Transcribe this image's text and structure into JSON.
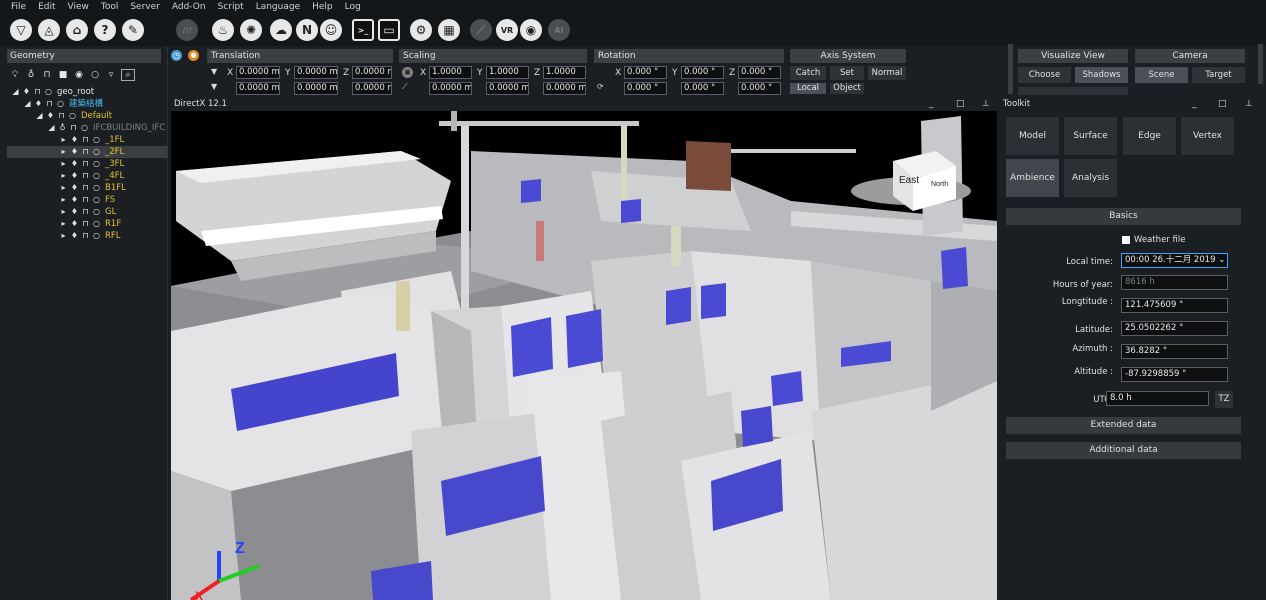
{
  "menu": [
    "File",
    "Edit",
    "View",
    "Tool",
    "Server",
    "Add-On",
    "Script",
    "Language",
    "Help",
    "Log"
  ],
  "toolbar_icons": [
    {
      "name": "filter-icon",
      "glyph": "▽"
    },
    {
      "name": "plane-icon",
      "glyph": "◬"
    },
    {
      "name": "house-icon",
      "glyph": "⌂"
    },
    {
      "name": "help-icon",
      "glyph": "?"
    },
    {
      "name": "measure-icon",
      "glyph": "✎"
    },
    {
      "name": "section-icon",
      "glyph": "///"
    },
    {
      "name": "fire-icon",
      "glyph": "♨"
    },
    {
      "name": "particle-icon",
      "glyph": "✺"
    },
    {
      "name": "weather-icon",
      "glyph": "☁"
    },
    {
      "name": "network-icon",
      "glyph": "N"
    },
    {
      "name": "person-icon",
      "glyph": "☺"
    },
    {
      "name": "console-icon",
      "glyph": ">_"
    },
    {
      "name": "window-icon",
      "glyph": "▭"
    },
    {
      "name": "settings-icon",
      "glyph": "⚙"
    },
    {
      "name": "grid-icon",
      "glyph": "▦"
    },
    {
      "name": "chart-icon",
      "glyph": "⟋"
    },
    {
      "name": "vr-icon",
      "glyph": "VR"
    },
    {
      "name": "screenshot-icon",
      "glyph": "◉"
    },
    {
      "name": "ai-icon",
      "glyph": "AI"
    }
  ],
  "geometry": {
    "title": "Geometry",
    "tree": [
      {
        "label": "geo_root",
        "depth": 0,
        "color": "white"
      },
      {
        "label": "建築結構",
        "depth": 1,
        "color": "cyan"
      },
      {
        "label": "Default",
        "depth": 2,
        "color": "yellow"
      },
      {
        "label": "IFCBUILDING_IFC",
        "depth": 3,
        "color": "grey"
      },
      {
        "label": "_1FL",
        "depth": 4,
        "color": "yellow"
      },
      {
        "label": "_2FL",
        "depth": 4,
        "color": "yellow",
        "selected": true
      },
      {
        "label": "_3FL",
        "depth": 4,
        "color": "yellow"
      },
      {
        "label": "_4FL",
        "depth": 4,
        "color": "yellow"
      },
      {
        "label": "B1FL",
        "depth": 4,
        "color": "yellow"
      },
      {
        "label": "FS",
        "depth": 4,
        "color": "yellow"
      },
      {
        "label": "GL",
        "depth": 4,
        "color": "yellow"
      },
      {
        "label": "R1F",
        "depth": 4,
        "color": "yellow"
      },
      {
        "label": "RFL",
        "depth": 4,
        "color": "yellow"
      }
    ]
  },
  "transform": {
    "translation_title": "Translation",
    "scaling_title": "Scaling",
    "rotation_title": "Rotation",
    "translation": [
      "0.0000 m",
      "0.0000 m",
      "0.0000 m",
      "0.0000 m",
      "0.0000 m",
      "0.0000 m"
    ],
    "scaling": [
      "1.0000",
      "1.0000",
      "1.0000",
      "0.0000 m",
      "0.0000 m",
      "0.0000 m"
    ],
    "rotation": [
      "0.000 °",
      "0.000 °",
      "0.000 °",
      "0.000 °",
      "0.000 °",
      "0.000 °"
    ],
    "axis_labels": [
      "X",
      "Y",
      "Z"
    ]
  },
  "axis_system": {
    "title": "Axis System",
    "catch": "Catch",
    "set": "Set",
    "normal": "Normal",
    "local": "Local",
    "object": "Object"
  },
  "visualize": {
    "title": "Visualize View",
    "choose": "Choose",
    "shadows": "Shadows"
  },
  "camera": {
    "title": "Camera",
    "scene": "Scene",
    "target": "Target"
  },
  "viewport": {
    "title": "DirectX 12.1",
    "compass_east": "East",
    "compass_north": "North",
    "axis_z": "Z",
    "axis_x": "X"
  },
  "toolkit": {
    "title": "Toolkit",
    "tabs": [
      "Model",
      "Surface",
      "Edge",
      "Vertex",
      "Ambience",
      "Analysis"
    ],
    "basics": "Basics",
    "weather_file": "Weather file",
    "local_time_label": "Local time:",
    "local_time_value": "00:00 26.十二月 2019 ⌄",
    "hours_label": "Hours of year:",
    "hours_value": "8616 h",
    "longitude_label": "Longtitude :",
    "longitude_value": "121.475609 °",
    "latitude_label": "Latitude:",
    "latitude_value": "25.0502262 °",
    "azimuth_label": "Azimuth :",
    "azimuth_value": "36.8282 °",
    "altitude_label": "Altitude :",
    "altitude_value": "-87.9298859 °",
    "utc_label": "UTC:",
    "utc_value": "8.0 h",
    "tz_button": "TZ",
    "extended": "Extended data",
    "additional": "Additional data"
  }
}
